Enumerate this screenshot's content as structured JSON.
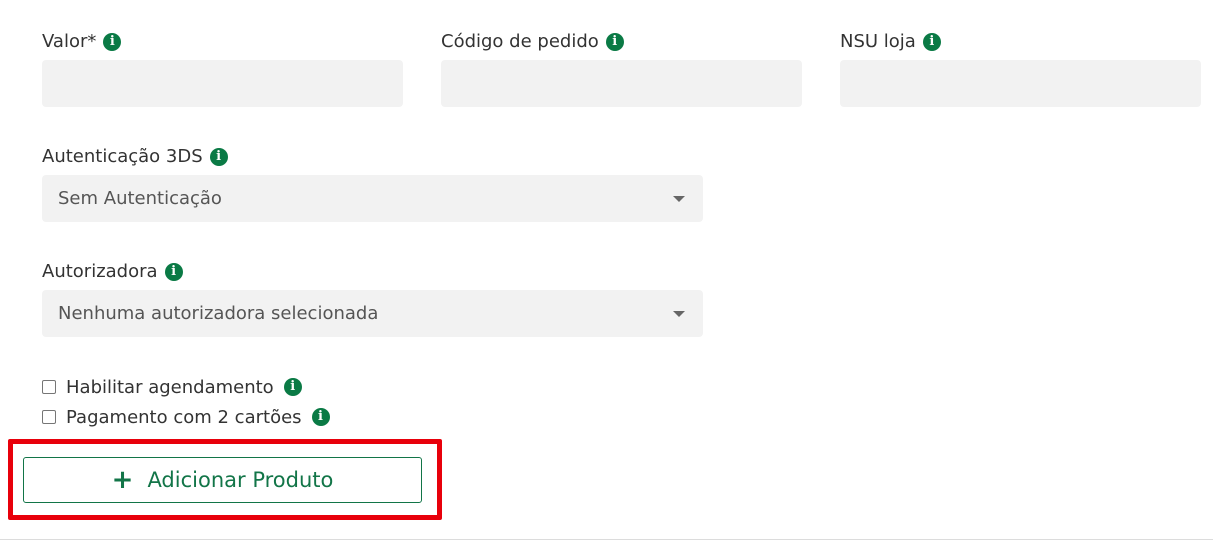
{
  "fields": {
    "valor": {
      "label": "Valor*",
      "value": ""
    },
    "codigo_pedido": {
      "label": "Código de pedido",
      "value": ""
    },
    "nsu_loja": {
      "label": "NSU loja",
      "value": ""
    }
  },
  "autenticacao": {
    "label": "Autenticação 3DS",
    "selected": "Sem Autenticação"
  },
  "autorizadora": {
    "label": "Autorizadora",
    "selected": "Nenhuma autorizadora selecionada"
  },
  "checkboxes": {
    "agendamento": {
      "label": "Habilitar agendamento",
      "checked": false
    },
    "dois_cartoes": {
      "label": "Pagamento com 2 cartões",
      "checked": false
    }
  },
  "add_product": {
    "label": "Adicionar Produto",
    "icon": "plus-icon"
  },
  "icons": {
    "info": "i"
  },
  "colors": {
    "accent": "#127548",
    "info_icon": "#0a7a45",
    "highlight": "#e8000b",
    "field_bg": "#f2f2f2"
  }
}
